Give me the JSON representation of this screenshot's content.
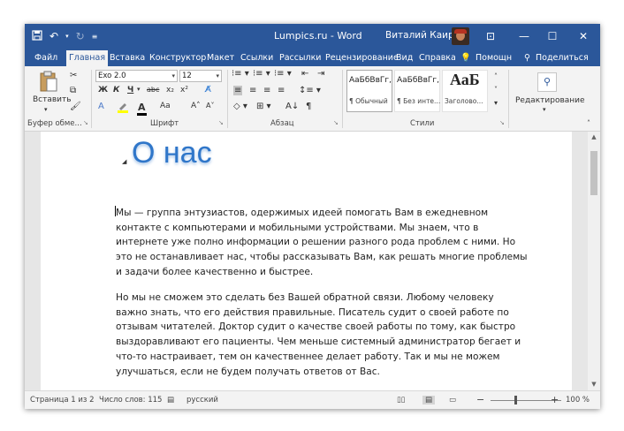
{
  "titlebar": {
    "title": "Lumpics.ru  -  Word",
    "user": "Виталий Каиров",
    "minimize": "—",
    "restore": "☐",
    "close": "✕",
    "ribbon_display": "⊡"
  },
  "tabs": [
    "Файл",
    "Главная",
    "Вставка",
    "Конструктор",
    "Макет",
    "Ссылки",
    "Рассылки",
    "Рецензирование",
    "Вид",
    "Справка",
    "Помощн",
    "Поделиться"
  ],
  "ribbon": {
    "paste_label": "Вставить",
    "font_name": "Exo 2.0",
    "font_size": "12",
    "bold": "Ж",
    "italic": "К",
    "underline": "Ч",
    "strike": "abc",
    "subscript": "x₂",
    "superscript": "x²",
    "font_color_a": "A",
    "change_case": "Aa",
    "grow_font": "A˄",
    "shrink_font": "A˅",
    "styles": [
      {
        "preview": "АаБбВвГг,",
        "label": "¶ Обычный"
      },
      {
        "preview": "АаБбВвГг,",
        "label": "¶ Без инте..."
      },
      {
        "preview": "АаБ",
        "label": "Заголово..."
      }
    ],
    "editing_label": "Редактирование",
    "groups": [
      "Буфер обме...",
      "Шрифт",
      "Абзац",
      "Стили"
    ]
  },
  "document": {
    "heading": "О нас",
    "paragraph1": [
      "Мы — группа энтузиастов, одержимых идеей помогать Вам в ежедневном",
      "контакте с компьютерами и мобильными устройствами. Мы знаем, что в",
      "интернете уже полно информации о решении разного рода проблем с ними. Но",
      "это не останавливает нас, чтобы рассказывать Вам, как решать многие проблемы",
      "и задачи более качественно и быстрее."
    ],
    "paragraph2": [
      "Но мы не сможем это сделать без Вашей обратной связи. Любому человеку",
      "важно знать, что его действия правильные. Писатель судит о своей работе по",
      "отзывам читателей. Доктор судит о качестве своей работы по тому, как быстро",
      "выздоравливают его пациенты. Чем меньше системный администратор бегает и",
      "что-то настраивает, тем он качественнее делает работу. Так и мы не можем",
      "улучшаться, если не будем получать ответов от Вас."
    ]
  },
  "status": {
    "page": "Страница 1 из 2",
    "words": "Число слов: 115",
    "language": "русский",
    "zoom": "100 %",
    "zoom_minus": "−",
    "zoom_plus": "+"
  },
  "colors": {
    "titlebar": "#2b579a",
    "heading": "#2f76c9"
  }
}
